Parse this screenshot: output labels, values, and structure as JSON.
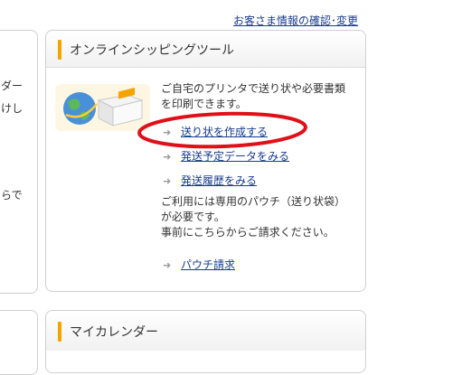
{
  "header": {
    "account_link": "お客さま情報の確認･変更"
  },
  "left_panel": {
    "fragments": [
      "ダー",
      "けし",
      "らで"
    ]
  },
  "shipping_panel": {
    "title": "オンラインシッピングツール",
    "description_line1": "ご自宅のプリンタで送り状や必要書類",
    "description_line2": "を印刷できます。",
    "links": [
      {
        "label": "送り状を作成する",
        "icon": "arrow-right-icon"
      },
      {
        "label": "発送予定データをみる",
        "icon": "arrow-right-icon"
      },
      {
        "label": "発送履歴をみる",
        "icon": "arrow-right-icon"
      }
    ],
    "note_line1": "ご利用には専用のパウチ（送り状袋）",
    "note_line2": "が必要です。",
    "note_line3": "事前にこちらからご請求ください。",
    "pouch_link": {
      "label": "パウチ請求",
      "icon": "arrow-right-icon"
    },
    "illustration_icon": "globe-package-icon"
  },
  "calendar_panel": {
    "title": "マイカレンダー"
  },
  "colors": {
    "accent": "#f5a300",
    "link": "#1a3c8f",
    "annotation": "#e0101a"
  }
}
